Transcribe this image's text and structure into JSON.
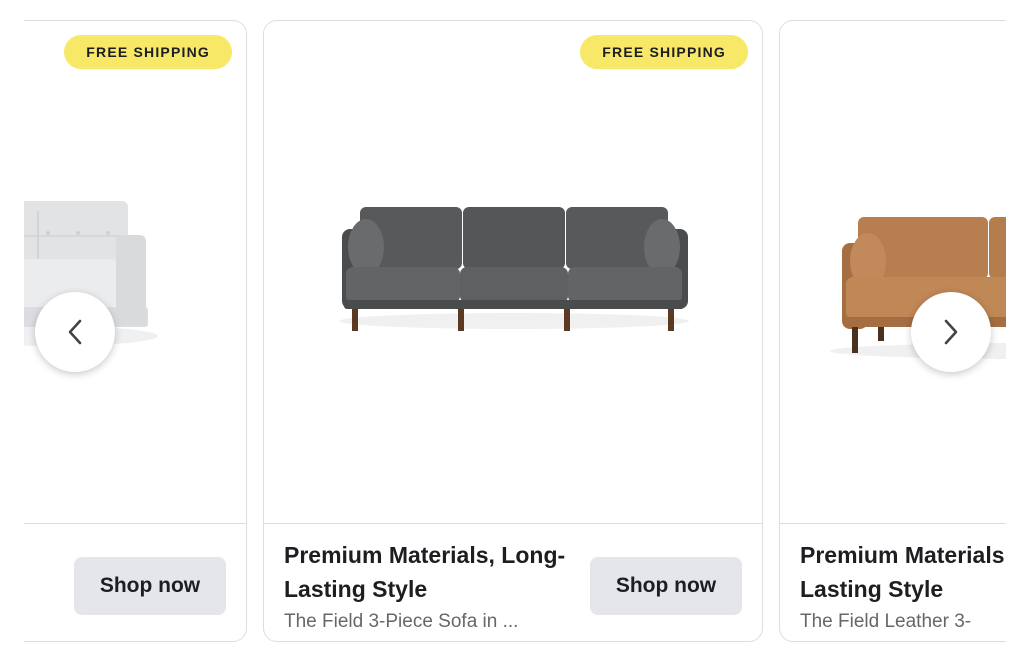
{
  "carousel": {
    "cards": [
      {
        "badge": "FREE SHIPPING",
        "headline": "",
        "description": "...",
        "cta": "Shop now",
        "image": "white-leather-sofa-image"
      },
      {
        "badge": "FREE SHIPPING",
        "headline": "Premium Materials, Long-Lasting Style",
        "description": "The Field 3-Piece Sofa in ...",
        "cta": "Shop now",
        "image": "gray-3-piece-sofa-image"
      },
      {
        "badge": "",
        "headline": "Premium Materials, Long-Lasting Style",
        "description": "The Field Leather 3-",
        "cta": "",
        "image": "tan-leather-sofa-image"
      }
    ],
    "prev_icon": "chevron-left-icon",
    "next_icon": "chevron-right-icon"
  },
  "colors": {
    "badge_bg": "#f7e867",
    "button_bg": "#e4e6eb",
    "text_primary": "#1c1e21",
    "text_secondary": "#65676b",
    "card_border": "#dcdde0"
  }
}
